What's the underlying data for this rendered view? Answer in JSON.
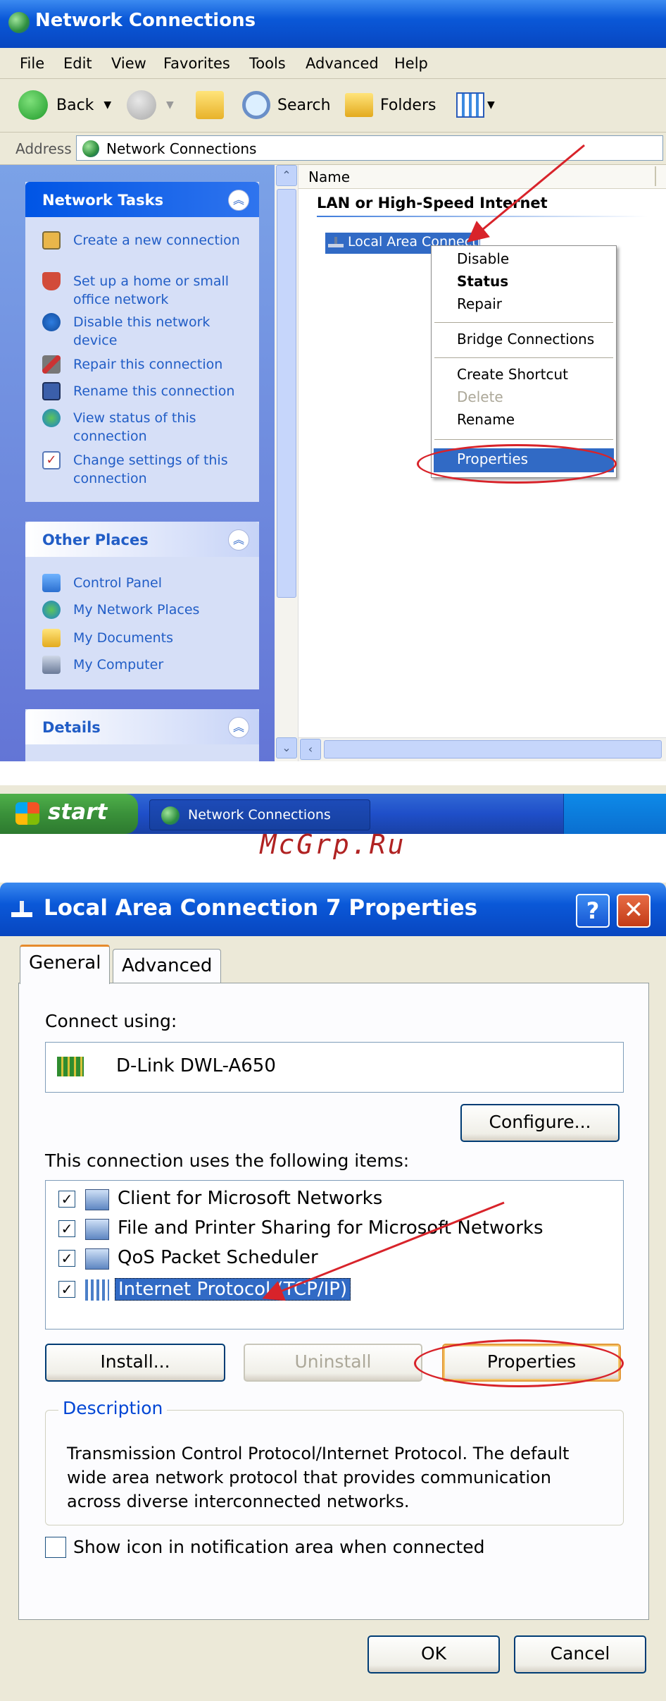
{
  "explorer": {
    "title": "Network Connections",
    "menu": [
      "File",
      "Edit",
      "View",
      "Favorites",
      "Tools",
      "Advanced",
      "Help"
    ],
    "toolbar": {
      "back": "Back",
      "search": "Search",
      "folders": "Folders"
    },
    "address": {
      "label": "Address",
      "value": "Network Connections"
    },
    "network_tasks": {
      "title": "Network Tasks",
      "items": [
        "Create a new connection",
        "Set up a home or small office network",
        "Disable this network device",
        "Repair this connection",
        "Rename this connection",
        "View status of this connection",
        "Change settings of this connection"
      ]
    },
    "other_places": {
      "title": "Other Places",
      "items": [
        "Control Panel",
        "My Network Places",
        "My Documents",
        "My Computer"
      ]
    },
    "details": {
      "title": "Details"
    },
    "list": {
      "column": "Name",
      "group": "LAN or High-Speed Internet",
      "selected_item": "Local Area Connection"
    },
    "context_menu": [
      "Disable",
      "Status",
      "Repair",
      "Bridge Connections",
      "Create Shortcut",
      "Delete",
      "Rename",
      "Properties"
    ],
    "taskbar": {
      "start": "start",
      "task": "Network Connections"
    }
  },
  "watermark": "McGrp.Ru",
  "dialog": {
    "title": "Local Area Connection 7 Properties",
    "tabs": [
      "General",
      "Advanced"
    ],
    "connect_using_label": "Connect using:",
    "device": "D-Link DWL-A650",
    "configure_button": "Configure...",
    "items_label": "This connection uses the following items:",
    "items": [
      "Client for Microsoft Networks",
      "File and Printer Sharing for Microsoft Networks",
      "QoS Packet Scheduler",
      "Internet Protocol (TCP/IP)"
    ],
    "install_button": "Install...",
    "uninstall_button": "Uninstall",
    "properties_button": "Properties",
    "description_title": "Description",
    "description": "Transmission Control Protocol/Internet Protocol. The default wide area network protocol that provides communication across diverse interconnected networks.",
    "show_icon_label": "Show icon in notification area when connected",
    "ok_button": "OK",
    "cancel_button": "Cancel"
  },
  "colors": {
    "xp_blue": "#0a58d8",
    "highlight": "#316ac5",
    "annotation": "#d8232a",
    "panel": "#d6dff7"
  }
}
